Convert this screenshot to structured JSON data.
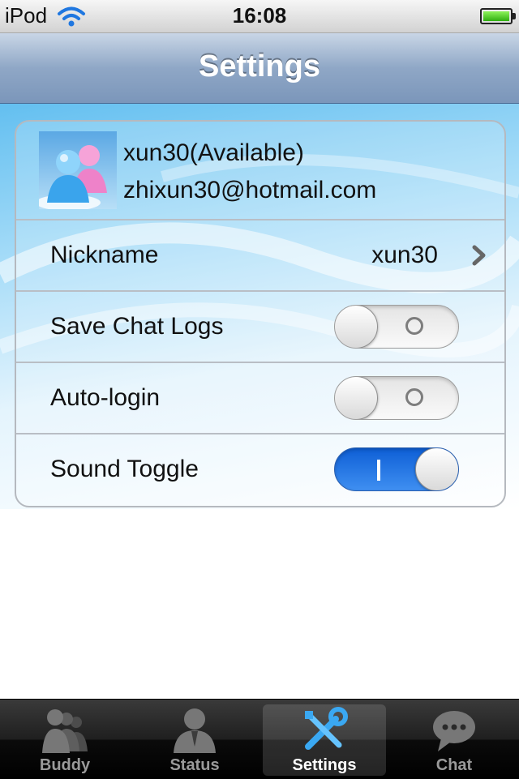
{
  "status_bar": {
    "carrier": "iPod",
    "time": "16:08",
    "icons": [
      "wifi-icon",
      "battery-icon"
    ],
    "battery_level": 1.0
  },
  "nav": {
    "title": "Settings"
  },
  "profile": {
    "name_status": "xun30(Available)",
    "email": "zhixun30@hotmail.com",
    "avatar_icon": "buddy-avatar-icon"
  },
  "settings": {
    "nickname": {
      "label": "Nickname",
      "value": "xun30",
      "icon": "chevron-right-icon"
    },
    "save_chat_logs": {
      "label": "Save Chat Logs",
      "on": false
    },
    "auto_login": {
      "label": "Auto-login",
      "on": false
    },
    "sound_toggle": {
      "label": "Sound Toggle",
      "on": true
    }
  },
  "tabs": [
    {
      "label": "Buddy",
      "icon": "buddy-icon",
      "active": false
    },
    {
      "label": "Status",
      "icon": "status-icon",
      "active": false
    },
    {
      "label": "Settings",
      "icon": "settings-tools-icon",
      "active": true
    },
    {
      "label": "Chat",
      "icon": "chat-bubble-icon",
      "active": false
    }
  ],
  "colors": {
    "toggle_on": "#1a6fe0",
    "nav_bar": "#8fa7c6",
    "tab_bar": "#1f1f1f"
  }
}
